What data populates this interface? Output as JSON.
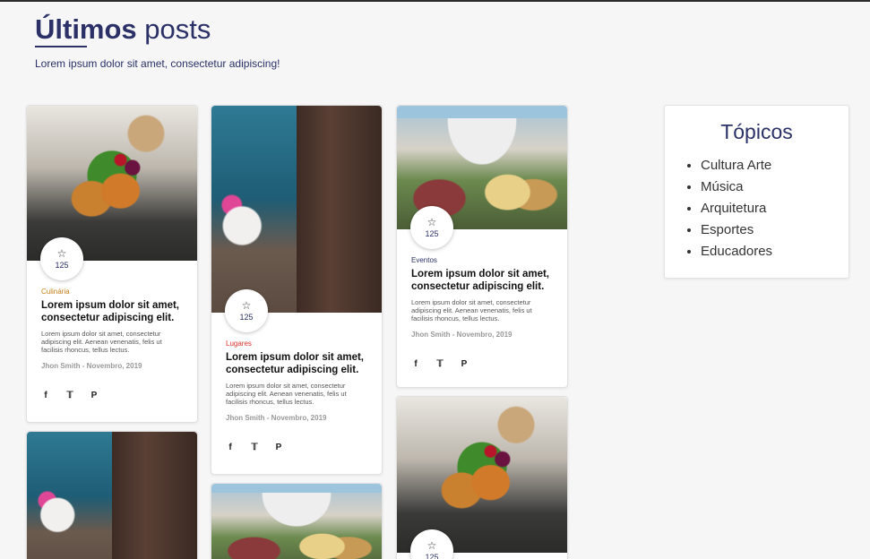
{
  "header": {
    "title_bold": "Últimos",
    "title_rest": " posts",
    "subtitle": "Lorem ipsum dolor sit amet, consectetur adipiscing!"
  },
  "cards": [
    {
      "category": "Culinária",
      "category_color": "#c57f16",
      "likes": "125",
      "title": "Lorem ipsum dolor sit amet, consectetur adipiscing elit.",
      "text": "Lorem ipsum dolor sit amet, consectetur adipiscing elit. Aenean venenatis, felis ut facilisis rhoncus, tellus lectus.",
      "author": "Jhon Smith - Novembro, 2019",
      "image": "food"
    },
    {
      "category": "Lugares",
      "category_color": "#d9302a",
      "likes": "125",
      "title": "Lorem ipsum dolor sit amet, consectetur adipiscing elit.",
      "text": "Lorem ipsum dolor sit amet, consectetur adipiscing elit. Aenean venenatis, felis ut facilisis rhoncus, tellus lectus.",
      "author": "Jhon Smith - Novembro, 2019",
      "image": "sea"
    },
    {
      "category": "Eventos",
      "category_color": "#2b3167",
      "likes": "125",
      "title": "Lorem ipsum dolor sit amet, consectetur adipiscing elit.",
      "text": "Lorem ipsum dolor sit amet, consectetur adipiscing elit. Aenean venenatis, felis ut facilisis rhoncus, tellus lectus.",
      "author": "Jhon Smith - Novembro, 2019",
      "image": "festival"
    },
    {
      "likes": "125",
      "image": "food"
    }
  ],
  "social": {
    "facebook": "f",
    "twitter": "🐦",
    "pinterest": "℘"
  },
  "star_icon": "☆",
  "topics": {
    "title": "Tópicos",
    "items": [
      "Cultura Arte",
      "Música",
      "Arquitetura",
      "Esportes",
      "Educadores"
    ]
  }
}
